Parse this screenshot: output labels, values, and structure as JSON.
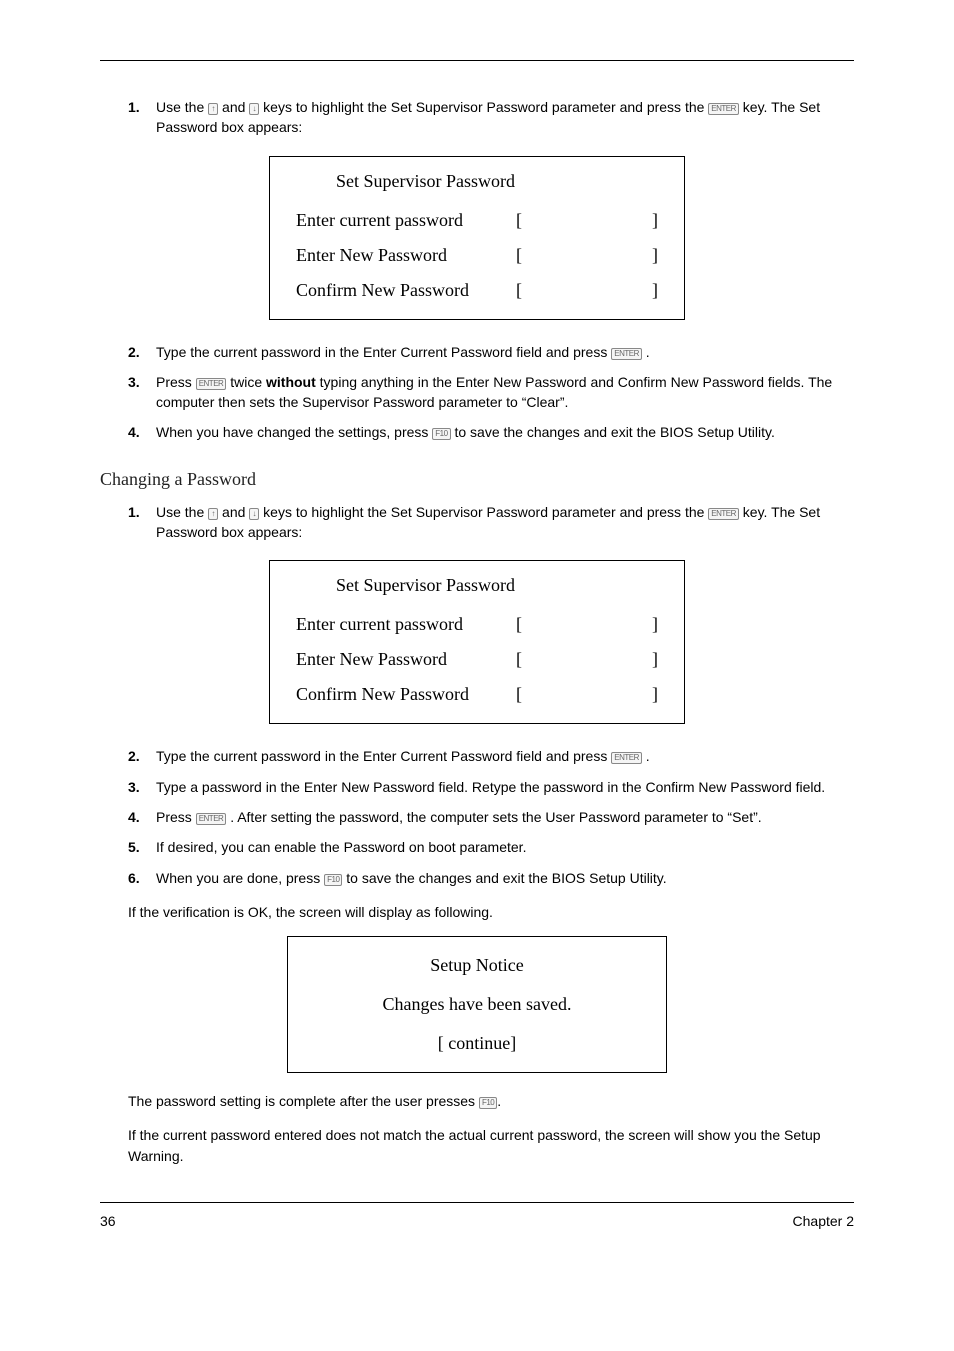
{
  "keys": {
    "up": "↑",
    "down": "↓",
    "enter": "ENTER",
    "f10": "F10"
  },
  "section1": {
    "steps": [
      {
        "num": "1.",
        "parts": [
          "Use the ",
          {
            "key": "up"
          },
          " and ",
          {
            "key": "down"
          },
          " keys to highlight the Set Supervisor Password parameter and press the ",
          {
            "key": "enter"
          },
          " key. The Set Password box appears:"
        ]
      }
    ],
    "box": {
      "title": "Set Supervisor Password",
      "rows": [
        {
          "label": "Enter current password",
          "value": ""
        },
        {
          "label": "Enter New Password",
          "value": ""
        },
        {
          "label": "Confirm New Password",
          "value": ""
        }
      ]
    },
    "steps_after": [
      {
        "num": "2.",
        "parts": [
          "Type the current password in the Enter Current Password field and press ",
          {
            "key": "enter"
          },
          " ."
        ]
      },
      {
        "num": "3.",
        "parts": [
          "Press ",
          {
            "key": "enter"
          },
          " twice ",
          {
            "bold": "without"
          },
          " typing anything in the Enter New Password and Confirm New Password fields. The computer then sets the Supervisor Password parameter to “Clear”."
        ]
      },
      {
        "num": "4.",
        "parts": [
          "When you have changed the settings, press ",
          {
            "key": "f10"
          },
          " to save the changes and exit the BIOS Setup Utility."
        ]
      }
    ]
  },
  "changing_heading": "Changing a Password",
  "section2": {
    "steps": [
      {
        "num": "1.",
        "parts": [
          "Use the ",
          {
            "key": "up"
          },
          " and ",
          {
            "key": "down"
          },
          " keys to highlight the Set Supervisor Password parameter and press the ",
          {
            "key": "enter"
          },
          " key. The Set Password box appears:"
        ]
      }
    ],
    "box": {
      "title": "Set Supervisor Password",
      "rows": [
        {
          "label": "Enter current password",
          "value": ""
        },
        {
          "label": "Enter New Password",
          "value": ""
        },
        {
          "label": "Confirm New Password",
          "value": ""
        }
      ]
    },
    "steps_after": [
      {
        "num": "2.",
        "parts": [
          "Type the current password in the Enter Current Password field and press ",
          {
            "key": "enter"
          },
          " ."
        ]
      },
      {
        "num": "3.",
        "parts": [
          "Type a password in the Enter New Password field. Retype the password in the Confirm New Password field."
        ]
      },
      {
        "num": "4.",
        "parts": [
          "Press ",
          {
            "key": "enter"
          },
          " . After setting the password, the computer sets the User Password parameter to “Set”."
        ]
      },
      {
        "num": "5.",
        "parts": [
          "If desired, you can enable the Password on boot parameter."
        ]
      },
      {
        "num": "6.",
        "parts": [
          "When you are done, press ",
          {
            "key": "f10"
          },
          " to save the changes and exit the BIOS Setup Utility."
        ]
      }
    ]
  },
  "verification_ok": "If the verification is OK, the screen will display as following.",
  "notice": {
    "title": "Setup Notice",
    "message": "Changes have been saved.",
    "continue": "[ continue]"
  },
  "after_notice_1_parts": [
    "The password setting is complete after the user presses ",
    {
      "key": "f10"
    },
    "."
  ],
  "after_notice_2": "If the current password entered does not match the actual current password, the screen will show you the Setup Warning.",
  "footer": {
    "page_number": "36",
    "chapter": "Chapter 2"
  }
}
